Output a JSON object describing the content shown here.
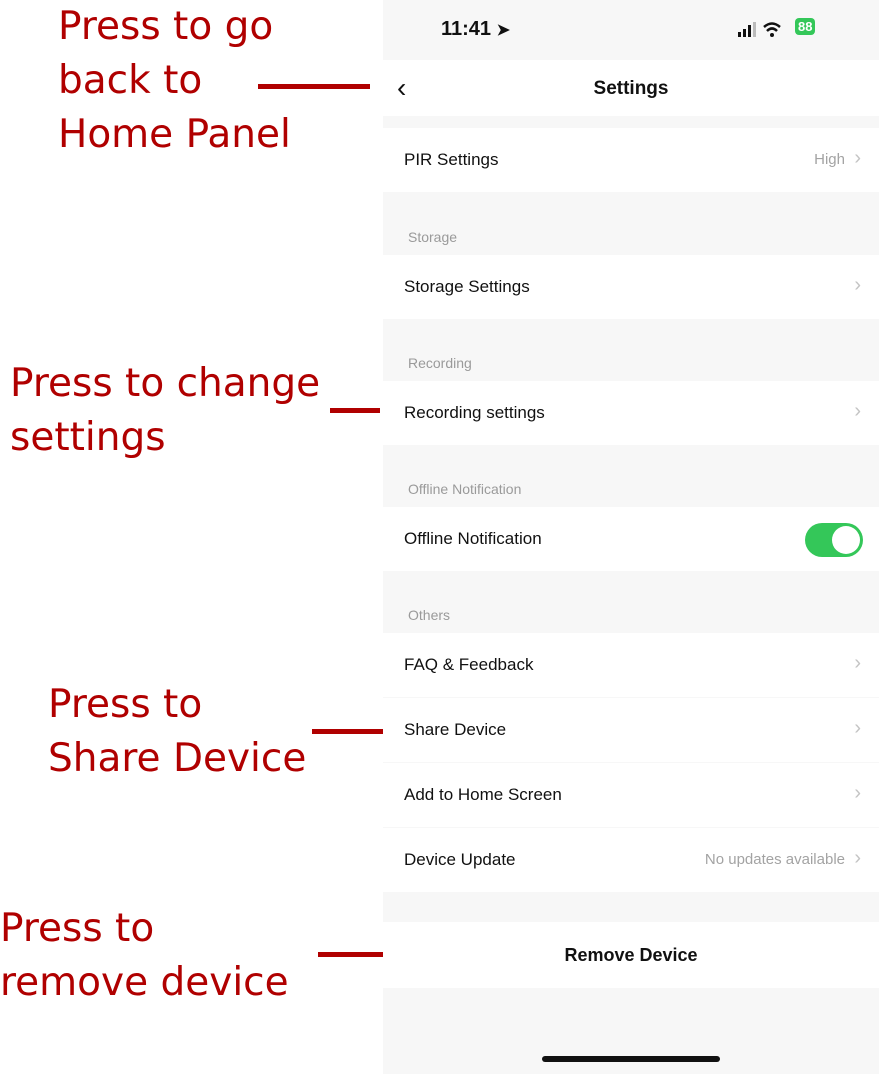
{
  "annotations": {
    "back": "Press to go\nback to\nHome Panel",
    "change": "Press to change\nsettings",
    "share": "Press to\nShare Device",
    "remove": "Press to\nremove device"
  },
  "status_bar": {
    "time": "11:41",
    "battery": "88"
  },
  "nav": {
    "title": "Settings",
    "back_icon": "chevron-left-icon"
  },
  "rows": {
    "pir": {
      "label": "PIR Settings",
      "value": "High"
    },
    "storage": {
      "label": "Storage Settings"
    },
    "recording": {
      "label": "Recording settings"
    },
    "offline": {
      "label": "Offline Notification",
      "enabled": true
    },
    "faq": {
      "label": "FAQ & Feedback"
    },
    "share": {
      "label": "Share Device"
    },
    "home_screen": {
      "label": "Add to Home Screen"
    },
    "update": {
      "label": "Device Update",
      "value": "No updates available"
    }
  },
  "sections": {
    "storage": "Storage",
    "recording": "Recording",
    "offline": "Offline Notification",
    "others": "Others"
  },
  "remove_label": "Remove Device",
  "colors": {
    "annotation": "#b00000",
    "toggle_on": "#34c759"
  }
}
